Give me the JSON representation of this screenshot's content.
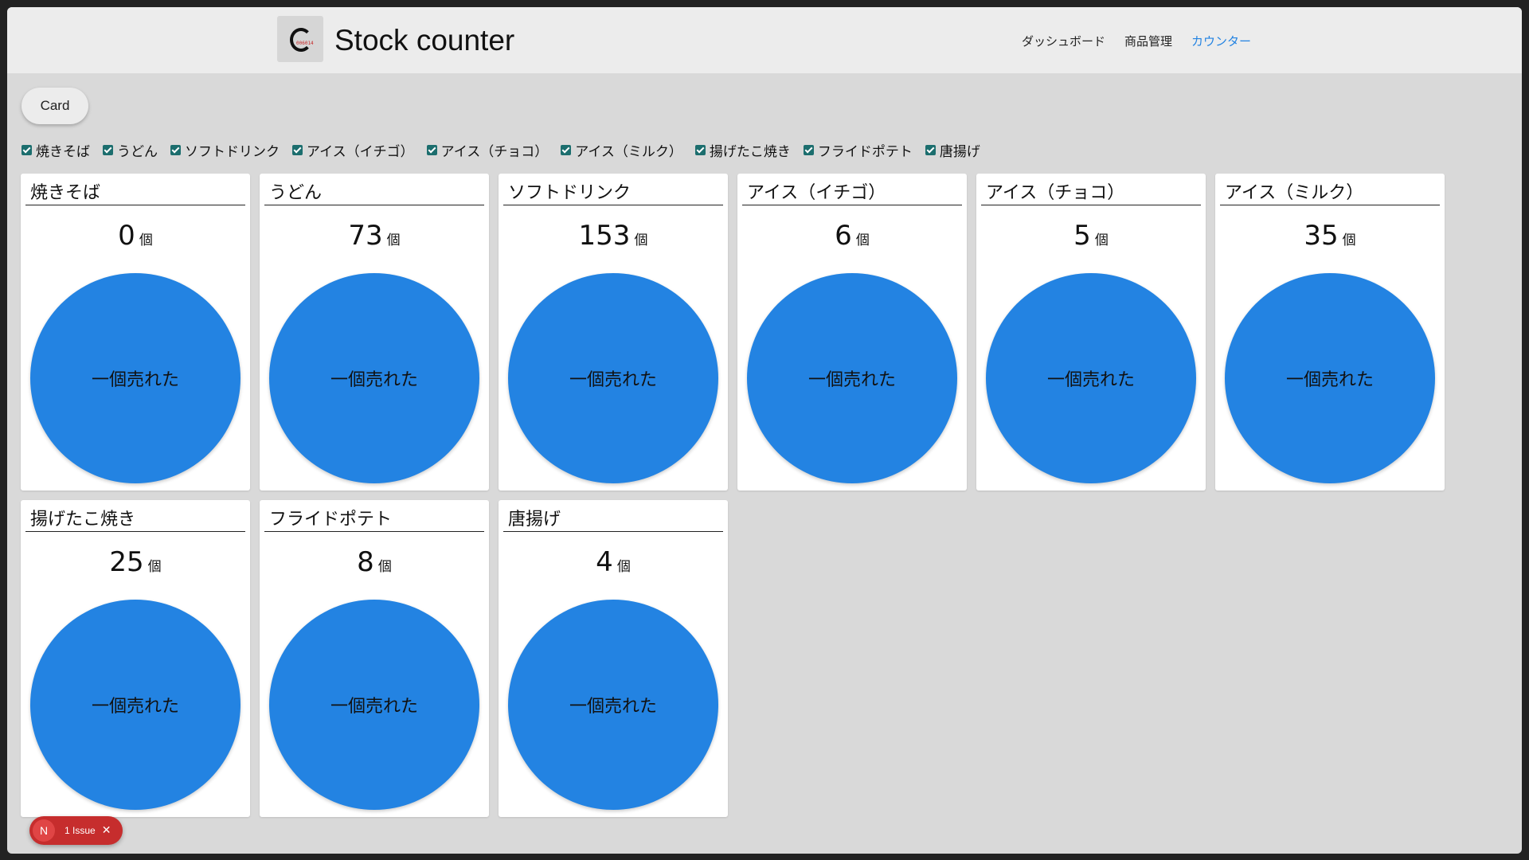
{
  "header": {
    "logo_text": "006014",
    "title": "Stock counter",
    "nav": [
      {
        "label": "ダッシュボード",
        "active": false
      },
      {
        "label": "商品管理",
        "active": false
      },
      {
        "label": "カウンター",
        "active": true
      }
    ]
  },
  "view_toggle": {
    "label": "Card"
  },
  "filters": [
    {
      "label": "焼きそば",
      "checked": true
    },
    {
      "label": "うどん",
      "checked": true
    },
    {
      "label": "ソフトドリンク",
      "checked": true
    },
    {
      "label": "アイス（イチゴ）",
      "checked": true
    },
    {
      "label": "アイス（チョコ）",
      "checked": true
    },
    {
      "label": "アイス（ミルク）",
      "checked": true
    },
    {
      "label": "揚げたこ焼き",
      "checked": true
    },
    {
      "label": "フライドポテト",
      "checked": true
    },
    {
      "label": "唐揚げ",
      "checked": true
    }
  ],
  "cards": [
    {
      "name": "焼きそば",
      "count": "0",
      "unit": "個",
      "button": "一個売れた"
    },
    {
      "name": "うどん",
      "count": "73",
      "unit": "個",
      "button": "一個売れた"
    },
    {
      "name": "ソフトドリンク",
      "count": "153",
      "unit": "個",
      "button": "一個売れた"
    },
    {
      "name": "アイス（イチゴ）",
      "count": "6",
      "unit": "個",
      "button": "一個売れた"
    },
    {
      "name": "アイス（チョコ）",
      "count": "5",
      "unit": "個",
      "button": "一個売れた"
    },
    {
      "name": "アイス（ミルク）",
      "count": "35",
      "unit": "個",
      "button": "一個売れた"
    },
    {
      "name": "揚げたこ焼き",
      "count": "25",
      "unit": "個",
      "button": "一個売れた"
    },
    {
      "name": "フライドポテト",
      "count": "8",
      "unit": "個",
      "button": "一個売れた"
    },
    {
      "name": "唐揚げ",
      "count": "4",
      "unit": "個",
      "button": "一個売れた"
    }
  ],
  "issue_badge": {
    "letter": "N",
    "text": "1 Issue",
    "close_icon": "close-icon"
  },
  "colors": {
    "accent": "#2383e2",
    "checkbox": "#1c6e6e",
    "background": "#d9d9d9",
    "header": "#ececec",
    "issue": "#c62d2d"
  }
}
